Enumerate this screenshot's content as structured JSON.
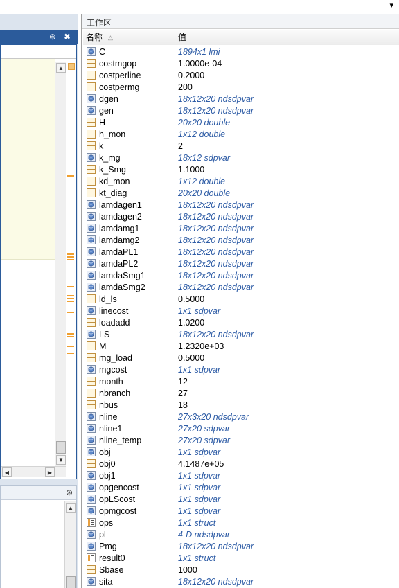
{
  "top_strip": {
    "menu_chevron_icon": "chevron-down-icon"
  },
  "editor_panel": {
    "header_buttons": [
      "panel-options-icon",
      "close-icon"
    ],
    "header_button_glyphs": [
      "⊛",
      "✖"
    ]
  },
  "workspace": {
    "title": "工作区",
    "columns": {
      "name": "名称",
      "value": "值"
    },
    "variables": [
      {
        "name": "C",
        "value": "1894x1 lmi",
        "kind": "object"
      },
      {
        "name": "costmgop",
        "value": "1.0000e-04",
        "kind": "numeric"
      },
      {
        "name": "costperline",
        "value": "0.2000",
        "kind": "numeric"
      },
      {
        "name": "costpermg",
        "value": "200",
        "kind": "numeric"
      },
      {
        "name": "dgen",
        "value": "18x12x20 ndsdpvar",
        "kind": "object"
      },
      {
        "name": "gen",
        "value": "18x12x20 ndsdpvar",
        "kind": "object"
      },
      {
        "name": "H",
        "value": "20x20 double",
        "kind": "matrix"
      },
      {
        "name": "h_mon",
        "value": "1x12 double",
        "kind": "matrix"
      },
      {
        "name": "k",
        "value": "2",
        "kind": "numeric"
      },
      {
        "name": "k_mg",
        "value": "18x12 sdpvar",
        "kind": "object"
      },
      {
        "name": "k_Smg",
        "value": "1.1000",
        "kind": "numeric"
      },
      {
        "name": "kd_mon",
        "value": "1x12 double",
        "kind": "matrix"
      },
      {
        "name": "kt_diag",
        "value": "20x20 double",
        "kind": "matrix"
      },
      {
        "name": "lamdagen1",
        "value": "18x12x20 ndsdpvar",
        "kind": "object"
      },
      {
        "name": "lamdagen2",
        "value": "18x12x20 ndsdpvar",
        "kind": "object"
      },
      {
        "name": "lamdamg1",
        "value": "18x12x20 ndsdpvar",
        "kind": "object"
      },
      {
        "name": "lamdamg2",
        "value": "18x12x20 ndsdpvar",
        "kind": "object"
      },
      {
        "name": "lamdaPL1",
        "value": "18x12x20 ndsdpvar",
        "kind": "object"
      },
      {
        "name": "lamdaPL2",
        "value": "18x12x20 ndsdpvar",
        "kind": "object"
      },
      {
        "name": "lamdaSmg1",
        "value": "18x12x20 ndsdpvar",
        "kind": "object"
      },
      {
        "name": "lamdaSmg2",
        "value": "18x12x20 ndsdpvar",
        "kind": "object"
      },
      {
        "name": "ld_ls",
        "value": "0.5000",
        "kind": "numeric"
      },
      {
        "name": "linecost",
        "value": "1x1 sdpvar",
        "kind": "object"
      },
      {
        "name": "loadadd",
        "value": "1.0200",
        "kind": "numeric"
      },
      {
        "name": "LS",
        "value": "18x12x20 ndsdpvar",
        "kind": "object"
      },
      {
        "name": "M",
        "value": "1.2320e+03",
        "kind": "numeric"
      },
      {
        "name": "mg_load",
        "value": "0.5000",
        "kind": "numeric"
      },
      {
        "name": "mgcost",
        "value": "1x1 sdpvar",
        "kind": "object"
      },
      {
        "name": "month",
        "value": "12",
        "kind": "numeric"
      },
      {
        "name": "nbranch",
        "value": "27",
        "kind": "numeric"
      },
      {
        "name": "nbus",
        "value": "18",
        "kind": "numeric"
      },
      {
        "name": "nline",
        "value": "27x3x20 ndsdpvar",
        "kind": "object"
      },
      {
        "name": "nline1",
        "value": "27x20 sdpvar",
        "kind": "object"
      },
      {
        "name": "nline_temp",
        "value": "27x20 sdpvar",
        "kind": "object"
      },
      {
        "name": "obj",
        "value": "1x1 sdpvar",
        "kind": "object"
      },
      {
        "name": "obj0",
        "value": "4.1487e+05",
        "kind": "numeric"
      },
      {
        "name": "obj1",
        "value": "1x1 sdpvar",
        "kind": "object"
      },
      {
        "name": "opgencost",
        "value": "1x1 sdpvar",
        "kind": "object"
      },
      {
        "name": "opLScost",
        "value": "1x1 sdpvar",
        "kind": "object"
      },
      {
        "name": "opmgcost",
        "value": "1x1 sdpvar",
        "kind": "object"
      },
      {
        "name": "ops",
        "value": "1x1 struct",
        "kind": "struct"
      },
      {
        "name": "pl",
        "value": "4-D ndsdpvar",
        "kind": "object"
      },
      {
        "name": "Pmg",
        "value": "18x12x20 ndsdpvar",
        "kind": "object"
      },
      {
        "name": "result0",
        "value": "1x1 struct",
        "kind": "struct"
      },
      {
        "name": "Sbase",
        "value": "1000",
        "kind": "numeric"
      },
      {
        "name": "sita",
        "value": "18x12x20 ndsdpvar",
        "kind": "object"
      }
    ]
  },
  "colors": {
    "panel_header_blue": "#2b5b9b",
    "object_value_blue": "#2f5da6",
    "editor_background": "#fbfbe6",
    "marker_orange": "#f0a030"
  }
}
